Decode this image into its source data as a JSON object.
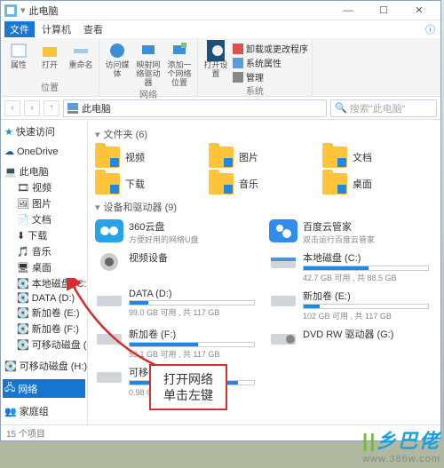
{
  "titlebar": {
    "title": "此电脑"
  },
  "menubar": {
    "file": "文件",
    "computer": "计算机",
    "view": "查看"
  },
  "ribbon": {
    "grp_pos": "位置",
    "grp_net": "网络",
    "grp_sys": "系统",
    "props": "属性",
    "open": "打开",
    "rename": "重命名",
    "media": "访问媒体",
    "map": "映射网络驱动器",
    "addloc": "添加一个网络位置",
    "cp": "打开设置",
    "uninstall": "卸载或更改程序",
    "sysprops": "系统属性",
    "manage": "管理"
  },
  "nav": {
    "back": "‹",
    "fwd": "›",
    "up": "↑",
    "loc": "此电脑"
  },
  "search": {
    "placeholder": "搜索\"此电脑\""
  },
  "tree": {
    "quick": "快速访问",
    "onedrive": "OneDrive",
    "thispc": "此电脑",
    "videos": "视频",
    "pictures": "图片",
    "docs": "文档",
    "downloads": "下载",
    "music": "音乐",
    "desktop": "桌面",
    "localc": "本地磁盘 (C:)",
    "datad": "DATA (D:)",
    "vole": "新加卷 (E:)",
    "volf": "新加卷 (F:)",
    "remg": "可移动磁盘 (G:)",
    "remh": "可移动磁盘 (H:)",
    "network": "网络",
    "homegroup": "家庭组"
  },
  "sec_folders": "文件夹 (6)",
  "folders": [
    "视频",
    "文档",
    "音乐",
    "图片",
    "下载",
    "桌面"
  ],
  "sec_drives": "设备和驱动器 (9)",
  "drives": {
    "d0": {
      "name": "360云盘",
      "sub": "方便好用的网络U盘"
    },
    "d1": {
      "name": "百度云管家",
      "sub": "双击运行百度云管家"
    },
    "d2": {
      "name": "视频设备",
      "sub": ""
    },
    "d3": {
      "name": "本地磁盘 (C:)",
      "sub": "42.7 GB 可用 , 共 88.5 GB",
      "pct": 52
    },
    "d4": {
      "name": "DATA (D:)",
      "sub": "99.0 GB 可用 , 共 117 GB",
      "pct": 15
    },
    "d5": {
      "name": "新加卷 (E:)",
      "sub": "102 GB 可用 , 共 117 GB",
      "pct": 13
    },
    "d6": {
      "name": "新加卷 (F:)",
      "sub": "53.1 GB 可用 , 共 117 GB",
      "pct": 55
    },
    "d7": {
      "name": "DVD RW 驱动器 (G:)",
      "sub": ""
    },
    "d8": {
      "name": "可移动磁盘 (H:)",
      "sub": "0.98 GB 可用 , 共 7.60 GB",
      "pct": 87
    }
  },
  "status": {
    "text": "15 个项目"
  },
  "callout": {
    "l1": "打开网络",
    "l2": "单击左键"
  },
  "watermark": {
    "brand": "乡巴佬",
    "url": "www.386w.com"
  }
}
